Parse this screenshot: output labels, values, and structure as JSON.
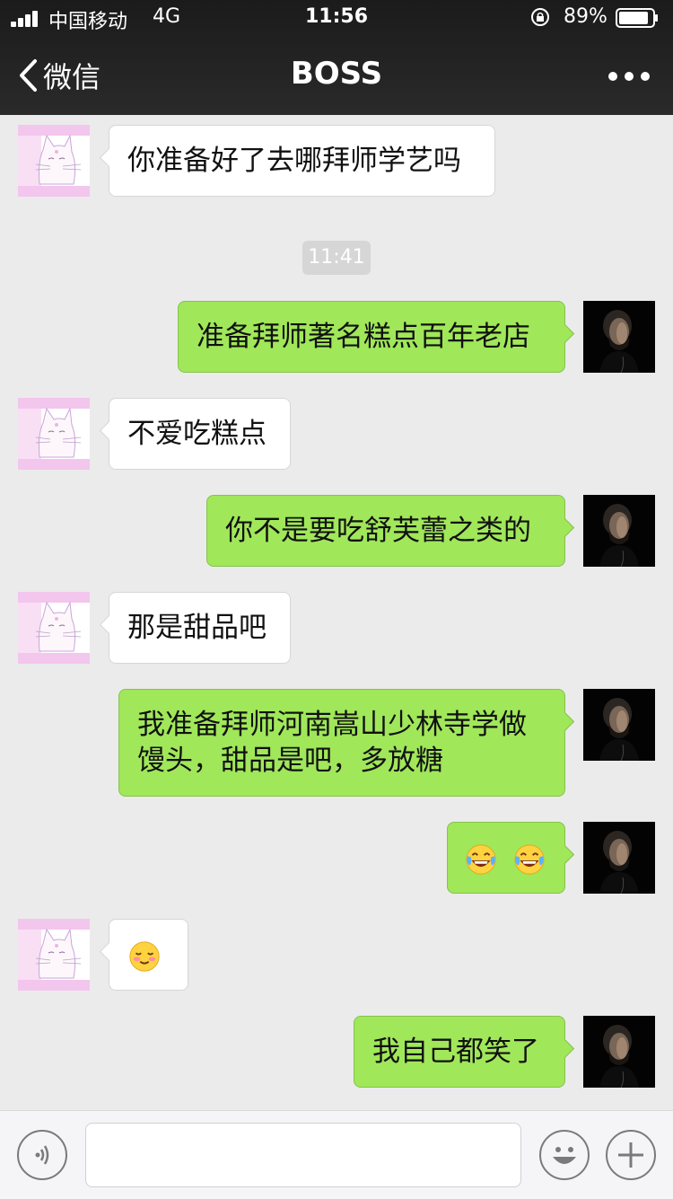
{
  "status_bar": {
    "carrier": "中国移动",
    "network": "4G",
    "time": "11:56",
    "battery_percent": "89%",
    "battery_level": 0.89
  },
  "nav": {
    "back_label": "微信",
    "title": "BOSS",
    "more_icon": "more-dots-icon"
  },
  "chat": {
    "timestamp": "11:41",
    "messages": [
      {
        "side": "left",
        "text": "你准备好了去哪拜师学艺吗"
      },
      {
        "side": "right",
        "text": "准备拜师著名糕点百年老店"
      },
      {
        "side": "left",
        "text": "不爱吃糕点"
      },
      {
        "side": "right",
        "text": "你不是要吃舒芙蕾之类的"
      },
      {
        "side": "left",
        "text": "那是甜品吧"
      },
      {
        "side": "right",
        "text": "我准备拜师河南嵩山少林寺学做馒头，甜品是吧，多放糖"
      },
      {
        "side": "right",
        "emoji": [
          "laughing-tears-emoji",
          "laughing-tears-emoji"
        ]
      },
      {
        "side": "left",
        "emoji": [
          "blushing-smile-emoji"
        ]
      },
      {
        "side": "right",
        "text": "我自己都笑了"
      }
    ]
  },
  "input_bar": {
    "voice_icon": "voice-icon",
    "emoji_icon": "smiley-icon",
    "plus_icon": "plus-icon",
    "text_value": ""
  },
  "colors": {
    "outgoing_bubble": "#a0e75a",
    "incoming_bubble": "#ffffff",
    "chat_background": "#ebebeb",
    "header_background": "#1b1b1b"
  }
}
